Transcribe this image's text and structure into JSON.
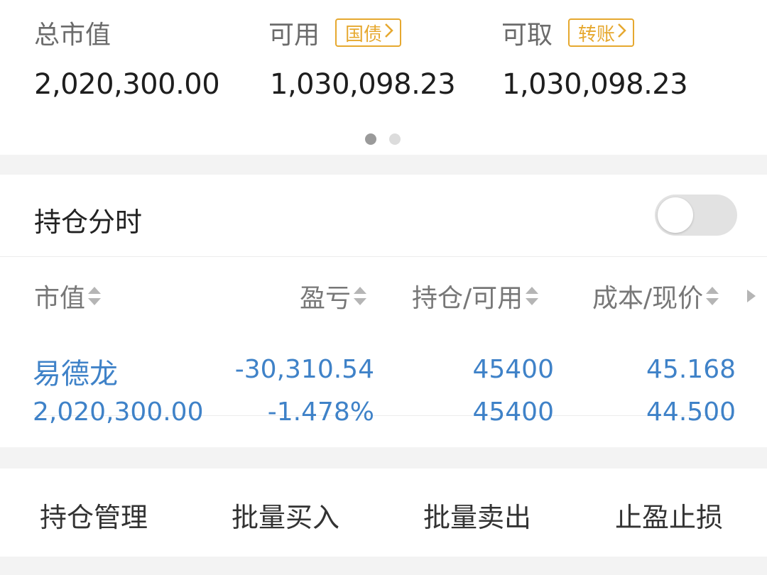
{
  "summary": {
    "total_market_value": {
      "label": "总市值",
      "value": "2,020,300.00"
    },
    "available": {
      "label": "可用",
      "tag": "国债",
      "value": "1,030,098.23"
    },
    "withdrawable": {
      "label": "可取",
      "tag": "转账",
      "value": "1,030,098.23"
    }
  },
  "pager": {
    "total": 2,
    "active": 1
  },
  "position_intraday": {
    "label": "持仓分时",
    "enabled": false
  },
  "table": {
    "headers": {
      "market_value": "市值",
      "profit_loss": "盈亏",
      "position_available": "持仓/可用",
      "cost_price": "成本/现价"
    },
    "rows": [
      {
        "name": "易德龙",
        "market_value": "2,020,300.00",
        "profit_loss": "-30,310.54",
        "profit_loss_pct": "-1.478%",
        "position": "45400",
        "available": "45400",
        "cost": "45.168",
        "price": "44.500"
      }
    ]
  },
  "actions": {
    "manage": "持仓管理",
    "batch_buy": "批量买入",
    "batch_sell": "批量卖出",
    "stop": "止盈止损"
  },
  "colors": {
    "accent_blue": "#3f82c8",
    "tag_orange": "#e6a82f",
    "label_gray": "#777777"
  }
}
